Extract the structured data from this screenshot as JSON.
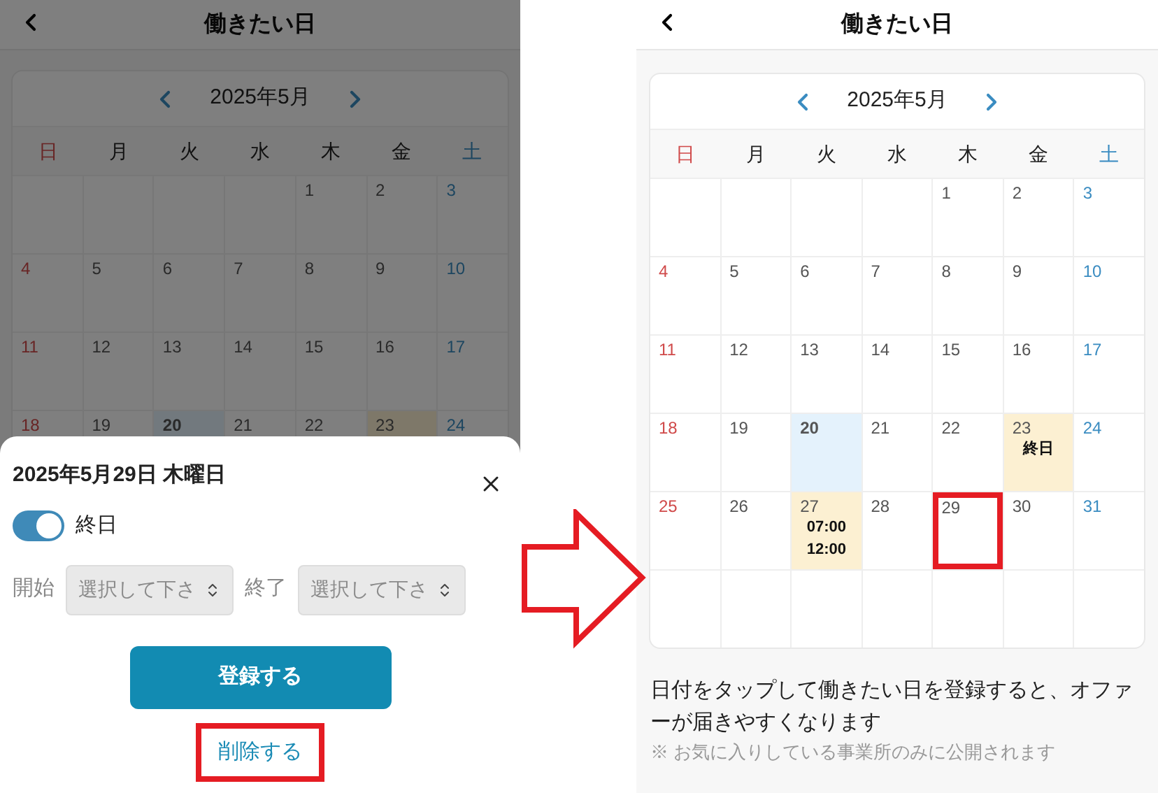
{
  "left_screen": {
    "header": {
      "title": "働きたい日"
    },
    "calendar": {
      "month": "2025年5月",
      "weekdays": [
        "日",
        "月",
        "火",
        "水",
        "木",
        "金",
        "土"
      ],
      "weeks": [
        [
          {
            "kind": "blank"
          },
          {
            "kind": "blank"
          },
          {
            "kind": "blank"
          },
          {
            "kind": "blank"
          },
          {
            "kind": "day",
            "day": "1",
            "today": false,
            "registered": false,
            "highlighted": false
          },
          {
            "kind": "day",
            "day": "2",
            "today": false,
            "registered": false,
            "highlighted": false
          },
          {
            "kind": "day",
            "day": "3",
            "today": false,
            "registered": false,
            "highlighted": false
          }
        ],
        [
          {
            "kind": "day",
            "day": "4",
            "today": false,
            "registered": false,
            "highlighted": false
          },
          {
            "kind": "day",
            "day": "5",
            "today": false,
            "registered": false,
            "highlighted": false
          },
          {
            "kind": "day",
            "day": "6",
            "today": false,
            "registered": false,
            "highlighted": false
          },
          {
            "kind": "day",
            "day": "7",
            "today": false,
            "registered": false,
            "highlighted": false
          },
          {
            "kind": "day",
            "day": "8",
            "today": false,
            "registered": false,
            "highlighted": false
          },
          {
            "kind": "day",
            "day": "9",
            "today": false,
            "registered": false,
            "highlighted": false
          },
          {
            "kind": "day",
            "day": "10",
            "today": false,
            "registered": false,
            "highlighted": false
          }
        ],
        [
          {
            "kind": "day",
            "day": "11",
            "today": false,
            "registered": false,
            "highlighted": false
          },
          {
            "kind": "day",
            "day": "12",
            "today": false,
            "registered": false,
            "highlighted": false
          },
          {
            "kind": "day",
            "day": "13",
            "today": false,
            "registered": false,
            "highlighted": false
          },
          {
            "kind": "day",
            "day": "14",
            "today": false,
            "registered": false,
            "highlighted": false
          },
          {
            "kind": "day",
            "day": "15",
            "today": false,
            "registered": false,
            "highlighted": false
          },
          {
            "kind": "day",
            "day": "16",
            "today": false,
            "registered": false,
            "highlighted": false
          },
          {
            "kind": "day",
            "day": "17",
            "today": false,
            "registered": false,
            "highlighted": false
          }
        ],
        [
          {
            "kind": "day",
            "day": "18",
            "today": false,
            "registered": false,
            "highlighted": false
          },
          {
            "kind": "day",
            "day": "19",
            "today": false,
            "registered": false,
            "highlighted": false
          },
          {
            "kind": "day",
            "day": "20",
            "today": true,
            "registered": false,
            "highlighted": false
          },
          {
            "kind": "day",
            "day": "21",
            "today": false,
            "registered": false,
            "highlighted": false
          },
          {
            "kind": "day",
            "day": "22",
            "today": false,
            "registered": false,
            "highlighted": false
          },
          {
            "kind": "day",
            "day": "23",
            "today": false,
            "registered": true,
            "highlighted": false
          },
          {
            "kind": "day",
            "day": "24",
            "today": false,
            "registered": false,
            "highlighted": false
          }
        ]
      ]
    },
    "sheet": {
      "date_title": "2025年5月29日 木曜日",
      "all_day": {
        "label": "終日",
        "on": true
      },
      "start": {
        "label": "開始",
        "placeholder": "選択して下さ",
        "disabled": true
      },
      "end": {
        "label": "終了",
        "placeholder": "選択して下さ",
        "disabled": true
      },
      "register_button": "登録する",
      "delete_button": {
        "label": "削除する",
        "highlighted": true
      }
    }
  },
  "right_screen": {
    "header": {
      "title": "働きたい日"
    },
    "calendar": {
      "month": "2025年5月",
      "weekdays": [
        "日",
        "月",
        "火",
        "水",
        "木",
        "金",
        "土"
      ],
      "weeks": [
        [
          {
            "kind": "blank"
          },
          {
            "kind": "blank"
          },
          {
            "kind": "blank"
          },
          {
            "kind": "blank"
          },
          {
            "kind": "day",
            "day": "1",
            "today": false,
            "registered": false,
            "highlighted": false
          },
          {
            "kind": "day",
            "day": "2",
            "today": false,
            "registered": false,
            "highlighted": false
          },
          {
            "kind": "day",
            "day": "3",
            "today": false,
            "registered": false,
            "highlighted": false
          }
        ],
        [
          {
            "kind": "day",
            "day": "4",
            "today": false,
            "registered": false,
            "highlighted": false
          },
          {
            "kind": "day",
            "day": "5",
            "today": false,
            "registered": false,
            "highlighted": false
          },
          {
            "kind": "day",
            "day": "6",
            "today": false,
            "registered": false,
            "highlighted": false
          },
          {
            "kind": "day",
            "day": "7",
            "today": false,
            "registered": false,
            "highlighted": false
          },
          {
            "kind": "day",
            "day": "8",
            "today": false,
            "registered": false,
            "highlighted": false
          },
          {
            "kind": "day",
            "day": "9",
            "today": false,
            "registered": false,
            "highlighted": false
          },
          {
            "kind": "day",
            "day": "10",
            "today": false,
            "registered": false,
            "highlighted": false
          }
        ],
        [
          {
            "kind": "day",
            "day": "11",
            "today": false,
            "registered": false,
            "highlighted": false
          },
          {
            "kind": "day",
            "day": "12",
            "today": false,
            "registered": false,
            "highlighted": false
          },
          {
            "kind": "day",
            "day": "13",
            "today": false,
            "registered": false,
            "highlighted": false
          },
          {
            "kind": "day",
            "day": "14",
            "today": false,
            "registered": false,
            "highlighted": false
          },
          {
            "kind": "day",
            "day": "15",
            "today": false,
            "registered": false,
            "highlighted": false
          },
          {
            "kind": "day",
            "day": "16",
            "today": false,
            "registered": false,
            "highlighted": false
          },
          {
            "kind": "day",
            "day": "17",
            "today": false,
            "registered": false,
            "highlighted": false
          }
        ],
        [
          {
            "kind": "day",
            "day": "18",
            "today": false,
            "registered": false,
            "highlighted": false
          },
          {
            "kind": "day",
            "day": "19",
            "today": false,
            "registered": false,
            "highlighted": false
          },
          {
            "kind": "day",
            "day": "20",
            "today": true,
            "registered": false,
            "highlighted": false
          },
          {
            "kind": "day",
            "day": "21",
            "today": false,
            "registered": false,
            "highlighted": false
          },
          {
            "kind": "day",
            "day": "22",
            "today": false,
            "registered": false,
            "highlighted": false
          },
          {
            "kind": "day",
            "day": "23",
            "today": false,
            "registered": true,
            "highlighted": false,
            "notes": [
              "終日"
            ]
          },
          {
            "kind": "day",
            "day": "24",
            "today": false,
            "registered": false,
            "highlighted": false
          }
        ],
        [
          {
            "kind": "day",
            "day": "25",
            "today": false,
            "registered": false,
            "highlighted": false
          },
          {
            "kind": "day",
            "day": "26",
            "today": false,
            "registered": false,
            "highlighted": false
          },
          {
            "kind": "day",
            "day": "27",
            "today": false,
            "registered": true,
            "highlighted": false,
            "notes": [
              "07:00",
              "12:00"
            ]
          },
          {
            "kind": "day",
            "day": "28",
            "today": false,
            "registered": false,
            "highlighted": false
          },
          {
            "kind": "day",
            "day": "29",
            "today": false,
            "registered": false,
            "highlighted": true
          },
          {
            "kind": "day",
            "day": "30",
            "today": false,
            "registered": false,
            "highlighted": false
          },
          {
            "kind": "day",
            "day": "31",
            "today": false,
            "registered": false,
            "highlighted": false
          }
        ],
        [
          {
            "kind": "blank"
          },
          {
            "kind": "blank"
          },
          {
            "kind": "blank"
          },
          {
            "kind": "blank"
          },
          {
            "kind": "blank"
          },
          {
            "kind": "blank"
          },
          {
            "kind": "blank"
          }
        ]
      ]
    },
    "notice": "日付をタップして働きたい日を登録すると、オファーが届きやすくなります",
    "footnote": "※ お気に入りしている事業所のみに公開されます"
  }
}
